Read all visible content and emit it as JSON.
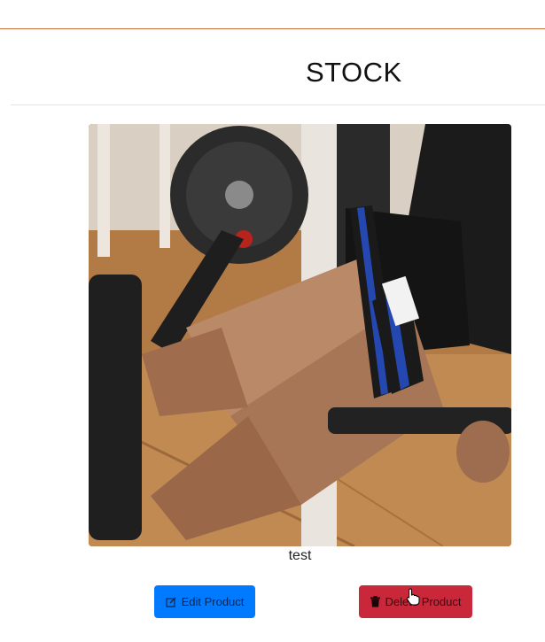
{
  "page": {
    "title": "STOCK"
  },
  "product": {
    "name": "test",
    "image_alt": "Athlete on leg curl machine wearing blood-flow restriction bands"
  },
  "actions": {
    "edit_label": "Edit Product",
    "edit_icon": "edit-icon",
    "delete_label": "Delete Product",
    "delete_icon": "trash-icon"
  },
  "colors": {
    "accent_rule": "#c8713c",
    "edit_button": "#007bff",
    "delete_button": "#c9283a"
  }
}
